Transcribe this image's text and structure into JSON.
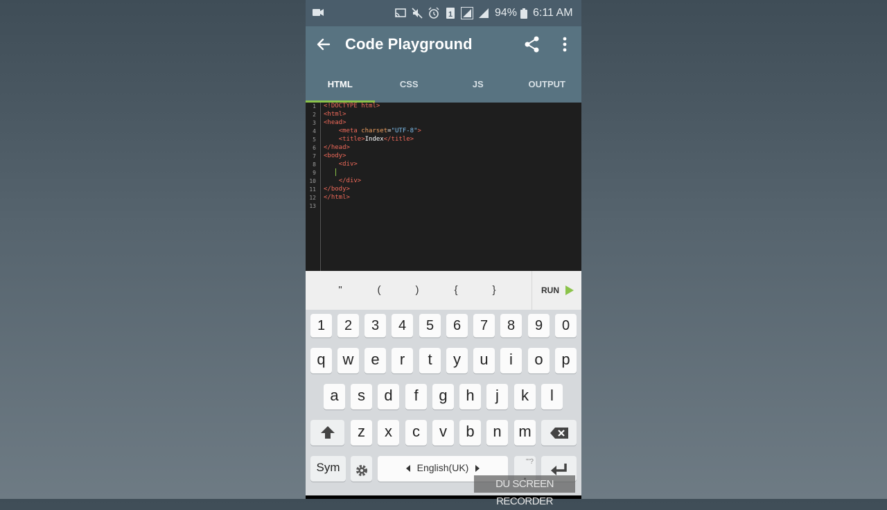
{
  "status_bar": {
    "battery": "94%",
    "time": "6:11 AM",
    "sim_slot": "1"
  },
  "app_bar": {
    "title": "Code Playground",
    "back_icon": "arrow-left-icon",
    "share_icon": "share-icon",
    "more_icon": "more-vert-icon",
    "color": "#587381"
  },
  "tabs": [
    {
      "label": "HTML",
      "active": true
    },
    {
      "label": "CSS",
      "active": false
    },
    {
      "label": "JS",
      "active": false
    },
    {
      "label": "OUTPUT",
      "active": false
    }
  ],
  "editor": {
    "line_numbers": [
      "1",
      "2",
      "3",
      "4",
      "5",
      "6",
      "7",
      "8",
      "9",
      "10",
      "11",
      "12",
      "13"
    ],
    "lines": [
      "<!DOCTYPE html>",
      "<html>",
      "<head>",
      "    <meta charset=\"UTF-8\">",
      "    <title>Index</title>",
      "</head>",
      "<body>",
      "    <div>",
      "",
      "    </div>",
      "</body>",
      "</html>",
      ""
    ],
    "tokens": {
      "doctype": "<!DOCTYPE html>",
      "html_open": "<html>",
      "head_open": "<head>",
      "meta_open": "<meta ",
      "meta_attr": "charset",
      "meta_eq": "=",
      "meta_val": "\"UTF-8\"",
      "meta_close": ">",
      "title_open": "<title>",
      "title_text": "Index",
      "title_close": "</title>",
      "head_close": "</head>",
      "body_open": "<body>",
      "div_open": "<div>",
      "div_close": "</div>",
      "body_close": "</body>",
      "html_close": "</html>"
    }
  },
  "symbol_bar": {
    "keys": [
      "\"",
      "(",
      ")",
      "{",
      "}"
    ],
    "run_label": "RUN",
    "run_color": "#8bc34a"
  },
  "keyboard": {
    "row1": [
      "1",
      "2",
      "3",
      "4",
      "5",
      "6",
      "7",
      "8",
      "9",
      "0"
    ],
    "row2": [
      "q",
      "w",
      "e",
      "r",
      "t",
      "y",
      "u",
      "i",
      "o",
      "p"
    ],
    "row3": [
      "a",
      "s",
      "d",
      "f",
      "g",
      "h",
      "j",
      "k",
      "l"
    ],
    "row4": [
      "z",
      "x",
      "c",
      "v",
      "b",
      "n",
      "m"
    ],
    "sym_label": "Sym",
    "space_label": "English(UK)",
    "punct_hint": "\"'?",
    "punct_main": ".",
    "icons": [
      "shift-icon",
      "backspace-icon",
      "settings-icon",
      "enter-icon"
    ]
  },
  "watermark": "DU SCREEN RECORDER"
}
